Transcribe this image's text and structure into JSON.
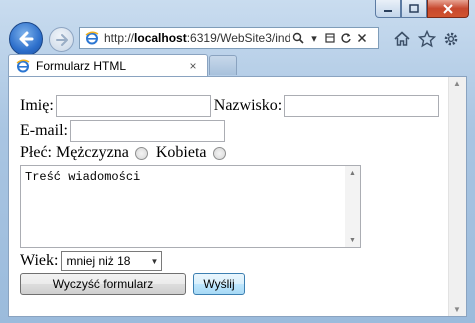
{
  "browser": {
    "url_prefix": "http://",
    "url_host": "localhost",
    "url_rest": ":6319/WebSite3/inde",
    "tab_title": "Formularz HTML",
    "tab_close": "×"
  },
  "form": {
    "first_name_label": "Imię:",
    "last_name_label": "Nazwisko:",
    "email_label": "E-mail:",
    "gender_label": "Płeć:",
    "gender_male": "Mężczyzna",
    "gender_female": "Kobieta",
    "message_text": "Treść wiadomości",
    "age_label": "Wiek:",
    "age_selected": "mniej niż 18",
    "reset_button": "Wyczyść formularz",
    "submit_button": "Wyślij"
  },
  "colors": {
    "chrome": "#a9c5e2",
    "close_button": "#c7482e",
    "back_button": "#2d6fcb"
  }
}
